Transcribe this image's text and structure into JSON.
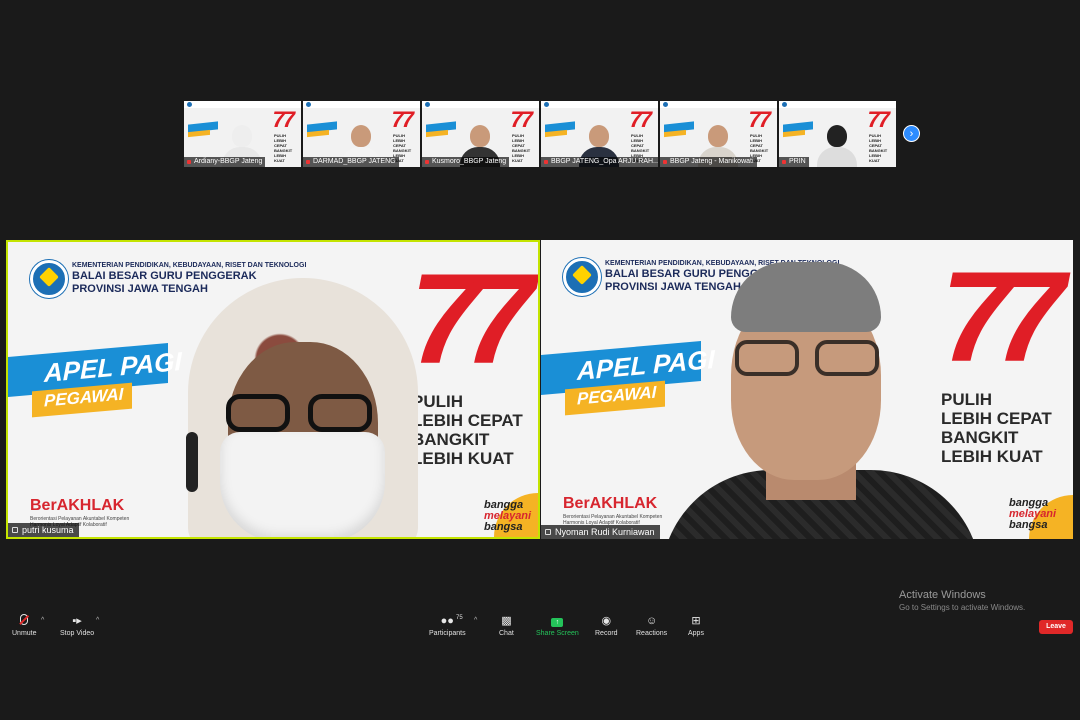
{
  "thumbnails": [
    {
      "name": "Ardiany-BBGP Jateng",
      "apel": "APEL PAGI"
    },
    {
      "name": "DARMAD_BBGP JATENG",
      "apel": "APEL PAGI"
    },
    {
      "name": "Kusmoro_BBGP Jateng",
      "apel": "SOSIALISASI"
    },
    {
      "name": "BBGP JATENG_Opa ARJU RAH...",
      "apel": "APEL PAGI"
    },
    {
      "name": "BBGP Jateng - Manikowati",
      "apel": "APEL PAGI"
    },
    {
      "name": "PRIN",
      "apel": "APEL PAGI"
    }
  ],
  "thumb_next": "›",
  "banner": {
    "ministry": "KEMENTERIAN PENDIDIKAN, KEBUDAYAAN, RISET DAN TEKNOLOGI",
    "org_line1": "BALAI BESAR GURU PENGGERAK",
    "org_line2": "PROVINSI JAWA TENGAH",
    "apel": "APEL PAGI",
    "pegawai": "PEGAWAI",
    "number": "77",
    "slogan1": "PULIH",
    "slogan2": "LEBIH CEPAT",
    "slogan3": "BANGKIT",
    "slogan4": "LEBIH KUAT",
    "berakhlak": "BerAKHLAK",
    "berakhlak_sub": "Berorientasi Pelayanan Akuntabel Kompeten Harmonis Loyal Adaptif Kolaboratif",
    "bangga1": "bangga",
    "bangga2": "melayani",
    "bangga3": "bangsa"
  },
  "main_tiles": [
    {
      "name": "putri kusuma"
    },
    {
      "name": "Nyoman Rudi Kurniawan"
    }
  ],
  "activate": {
    "title": "Activate Windows",
    "subtitle": "Go to Settings to activate Windows."
  },
  "toolbar": {
    "unmute": "Unmute",
    "stop_video": "Stop Video",
    "participants": "Participants",
    "participants_count": "75",
    "chat": "Chat",
    "share_screen": "Share Screen",
    "record": "Record",
    "reactions": "Reactions",
    "apps": "Apps",
    "leave": "Leave"
  }
}
